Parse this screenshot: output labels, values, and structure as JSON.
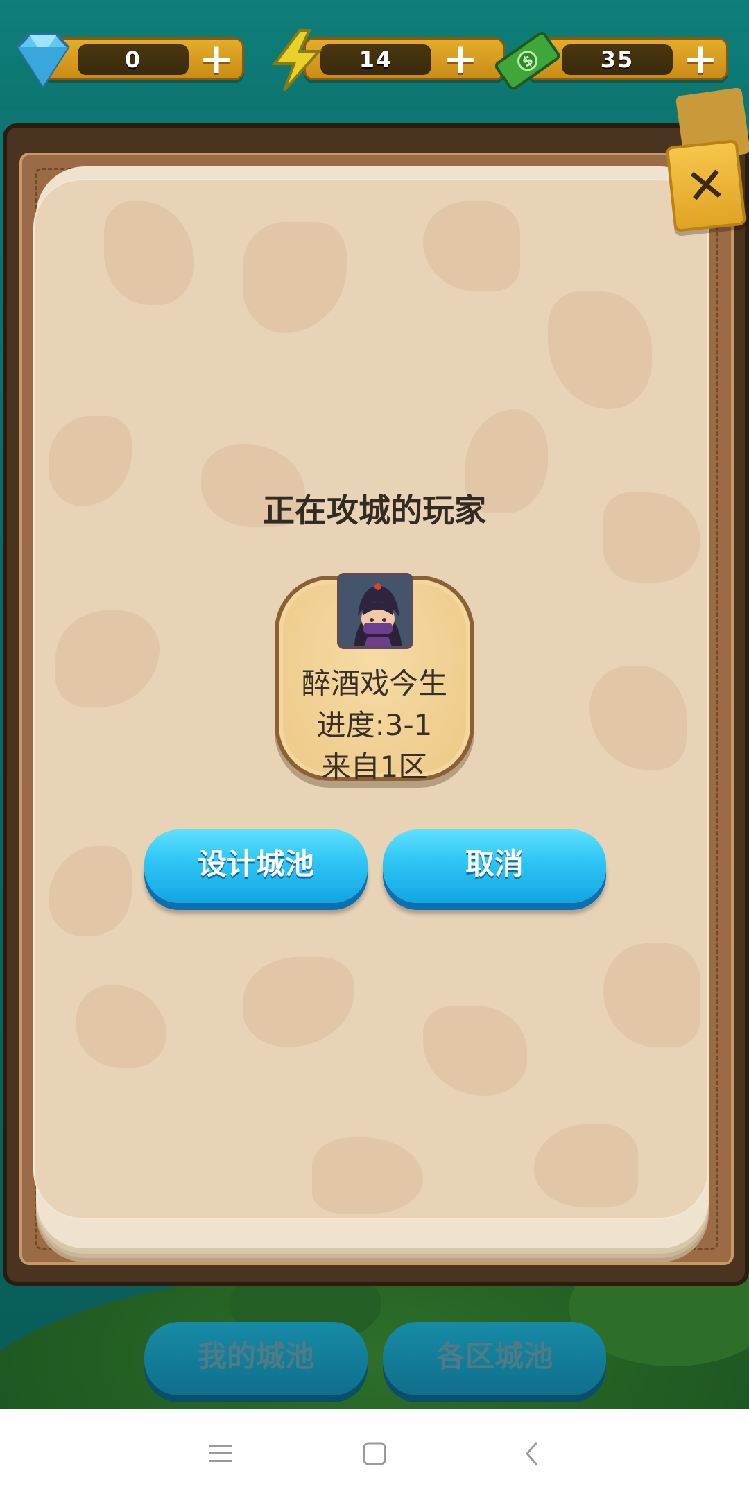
{
  "resources": [
    {
      "icon": "diamond-icon",
      "value": "0",
      "color": "#5ec7f2"
    },
    {
      "icon": "lightning-icon",
      "value": "14",
      "color": "#e8d22a"
    },
    {
      "icon": "cash-icon",
      "value": "35",
      "color": "#3fa63a"
    }
  ],
  "resource_plus": "+",
  "dialog": {
    "title": "正在攻城的玩家",
    "player": {
      "name": "醉酒戏今生",
      "progress": "进度:3-1",
      "region": "来自1区"
    },
    "design_button": "设计城池",
    "cancel_button": "取消",
    "close_glyph": "✕"
  },
  "background_buttons": {
    "my_castle": "我的城池",
    "all_regions": "各区城池"
  },
  "navbar": [
    "menu-icon",
    "home-icon",
    "back-icon"
  ]
}
